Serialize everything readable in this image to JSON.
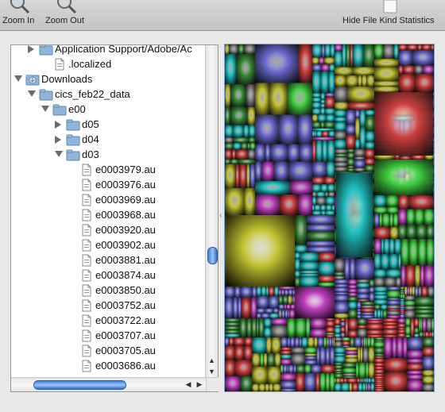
{
  "toolbar": {
    "zoom_in_label": "Zoom In",
    "zoom_out_label": "Zoom Out",
    "hide_stats_label": "Hide File Kind Statistics"
  },
  "tree": {
    "rows": [
      {
        "label": "Application Support/Adobe/Ac",
        "type": "folder",
        "disclosure": "closed"
      },
      {
        "label": ".localized",
        "type": "file",
        "disclosure": "none"
      },
      {
        "label": "Downloads",
        "type": "downloads-folder",
        "disclosure": "open"
      },
      {
        "label": "cics_feb22_data",
        "type": "folder",
        "disclosure": "open"
      },
      {
        "label": "e00",
        "type": "folder",
        "disclosure": "open"
      },
      {
        "label": "d05",
        "type": "folder",
        "disclosure": "closed"
      },
      {
        "label": "d04",
        "type": "folder",
        "disclosure": "closed"
      },
      {
        "label": "d03",
        "type": "folder",
        "disclosure": "open"
      },
      {
        "label": "e0003979.au",
        "type": "file",
        "disclosure": "none"
      },
      {
        "label": "e0003976.au",
        "type": "file",
        "disclosure": "none"
      },
      {
        "label": "e0003969.au",
        "type": "file",
        "disclosure": "none"
      },
      {
        "label": "e0003968.au",
        "type": "file",
        "disclosure": "none"
      },
      {
        "label": "e0003920.au",
        "type": "file",
        "disclosure": "none"
      },
      {
        "label": "e0003902.au",
        "type": "file",
        "disclosure": "none"
      },
      {
        "label": "e0003881.au",
        "type": "file",
        "disclosure": "none"
      },
      {
        "label": "e0003874.au",
        "type": "file",
        "disclosure": "none"
      },
      {
        "label": "e0003850.au",
        "type": "file",
        "disclosure": "none"
      },
      {
        "label": "e0003752.au",
        "type": "file",
        "disclosure": "none"
      },
      {
        "label": "e0003722.au",
        "type": "file",
        "disclosure": "none"
      },
      {
        "label": "e0003707.au",
        "type": "file",
        "disclosure": "none"
      },
      {
        "label": "e0003705.au",
        "type": "file",
        "disclosure": "none"
      },
      {
        "label": "e0003686.au",
        "type": "file",
        "disclosure": "none"
      }
    ]
  },
  "icons": {
    "zoom_in": "magnifier-icon",
    "zoom_out": "magnifier-icon",
    "hide_stats": "document-icon",
    "folder": "folder-icon",
    "file": "file-icon",
    "downloads": "downloads-folder-icon"
  },
  "colors": {
    "selection_thumb": "#3c7fd6",
    "treemap_border": "#7aa0d0"
  },
  "treemap_blocks": [
    {
      "color": "#3a8a3a"
    },
    {
      "color": "#6a6ad0"
    },
    {
      "color": "#d04040"
    },
    {
      "color": "#20c0c0"
    },
    {
      "color": "#c0c030"
    },
    {
      "color": "#c040c0"
    },
    {
      "color": "#808080"
    },
    {
      "color": "#40d040"
    }
  ]
}
